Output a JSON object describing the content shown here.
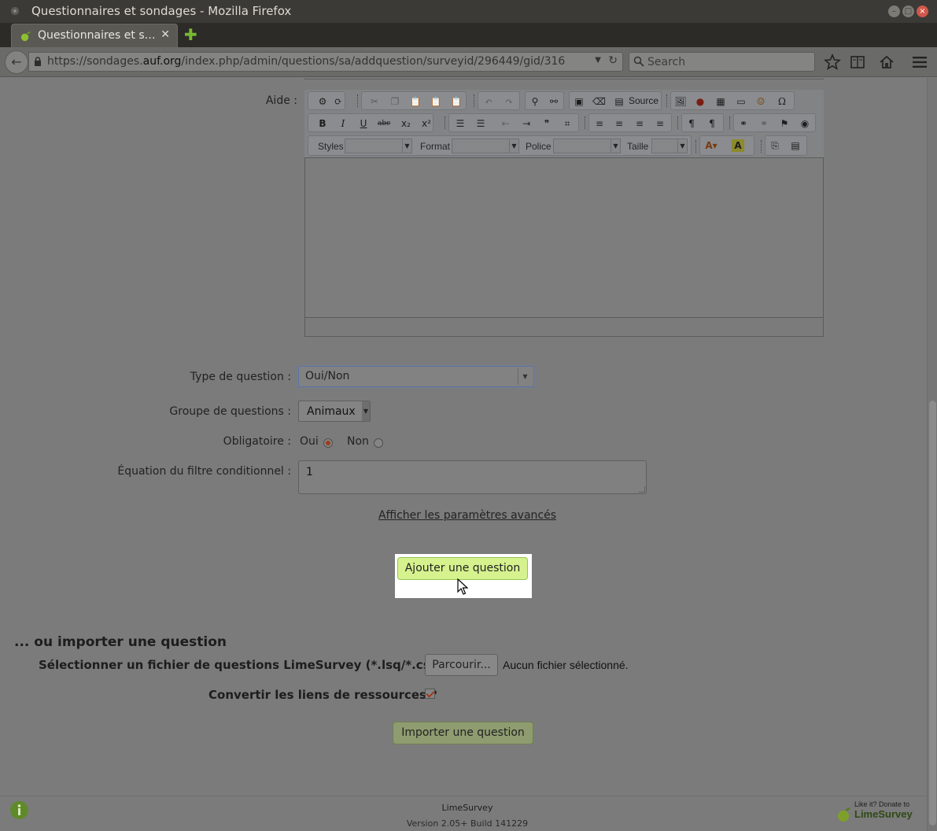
{
  "window": {
    "title": "Questionnaires et sondages - Mozilla Firefox"
  },
  "tab": {
    "title": "Questionnaires et s…",
    "close": "✕",
    "new_tab": "✚"
  },
  "navbar": {
    "url_prefix": "https://sondages.",
    "url_domain": "auf.org",
    "url_path": "/index.php/admin/questions/sa/addquestion/surveyid/296449/gid/316",
    "search_placeholder": "Search"
  },
  "editor": {
    "label": "Aide :",
    "source_label": "Source",
    "styles_label": "Styles",
    "format_label": "Format",
    "police_label": "Police",
    "taille_label": "Taille"
  },
  "form": {
    "type_label": "Type de question :",
    "type_value": "Oui/Non",
    "group_label": "Groupe de questions :",
    "group_value": "Animaux",
    "mandatory_label": "Obligatoire :",
    "mandatory_yes": "Oui",
    "mandatory_no": "Non",
    "mandatory_selected": "Oui",
    "filter_label": "Équation du filtre conditionnel :",
    "filter_value": "1",
    "advanced_link": "Afficher les paramètres avancés",
    "add_button": "Ajouter une question"
  },
  "import": {
    "title": "... ou importer une question",
    "file_label": "Sélectionner un fichier de questions LimeSurvey (*.lsq/*.csv):",
    "browse_button": "Parcourir...",
    "no_file": "Aucun fichier sélectionné.",
    "convert_label": "Convertir les liens de ressources ?",
    "convert_checked": true,
    "import_button": "Importer une question"
  },
  "footer": {
    "app_name": "LimeSurvey",
    "version": "Version 2.05+ Build 141229",
    "donate_small": "Like it? Donate to",
    "donate_brand": "LimeSurvey"
  },
  "colors": {
    "add_button_bg": "#d6f28e",
    "import_button_bg": "#8e9c70",
    "radio_selected": "#9e3b1e",
    "new_tab_green": "#79b932"
  }
}
